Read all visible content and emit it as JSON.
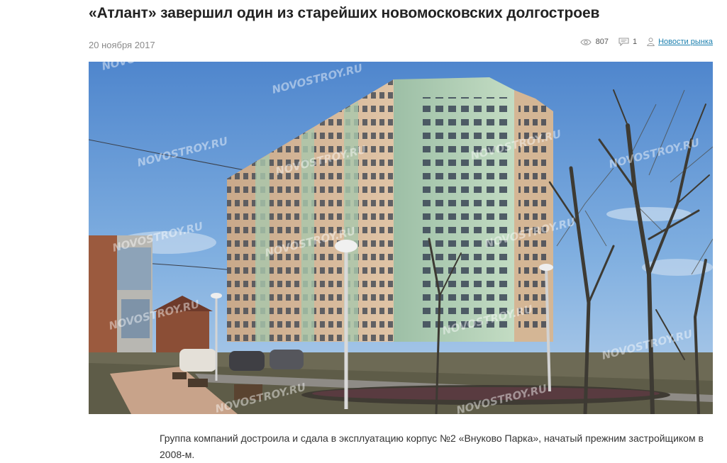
{
  "article": {
    "title": "«Атлант» завершил один из старейших новомосковских долгостроев",
    "date": "20 ноября 2017",
    "views": "807",
    "comments": "1",
    "category": "Новости рынка",
    "caption": "Группа компаний достроила и сдала в эксплуатацию корпус №2 «Внуково Парка», начатый прежним застройщиком в 2008-м."
  },
  "photo": {
    "watermark": "NOVOSTROY.RU",
    "icons": {
      "views": "eye-icon",
      "comments": "comment-icon",
      "category": "user-icon"
    }
  },
  "colors": {
    "link": "#1a7fae",
    "meta": "#8a8a8a",
    "sky": "#6fa3d8"
  }
}
